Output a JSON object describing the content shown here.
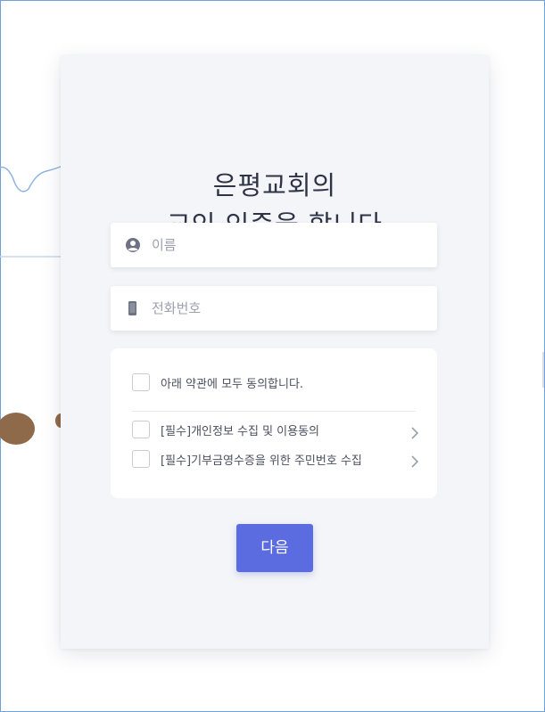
{
  "heading": {
    "line1": "은평교회의",
    "line2": "교인 인증을 합니다"
  },
  "form": {
    "name_placeholder": "이름",
    "phone_placeholder": "전화번호"
  },
  "agreements": {
    "all_label": "아래 약관에 모두 동의합니다.",
    "items": [
      {
        "label": "[필수]개인정보 수집 및 이용동의"
      },
      {
        "label": "[필수]기부금영수증을 위한 주민번호 수집"
      }
    ]
  },
  "actions": {
    "next_label": "다음"
  },
  "colors": {
    "accent": "#5b6be0",
    "card_bg": "#f4f5f8",
    "title": "#2e3446",
    "placeholder": "#9ba1ad"
  },
  "icons": {
    "name_field": "user-circle-icon",
    "phone_field": "phone-icon",
    "item_link": "chevron-right-icon"
  }
}
